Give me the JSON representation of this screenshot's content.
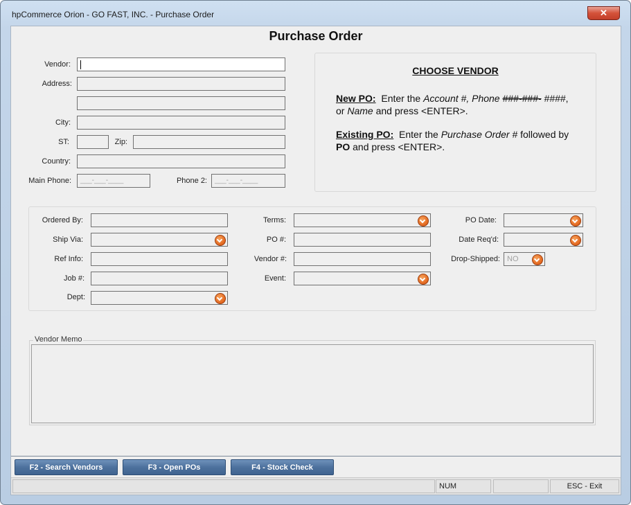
{
  "window": {
    "title": "hpCommerce Orion - GO FAST, INC. - Purchase Order",
    "close_glyph": "✕"
  },
  "page": {
    "heading": "Purchase Order"
  },
  "vendor_section": {
    "vendor_label": "Vendor:",
    "address_label": "Address:",
    "city_label": "City:",
    "st_label": "ST:",
    "zip_label": "Zip:",
    "country_label": "Country:",
    "main_phone_label": "Main Phone:",
    "main_phone_value": "___-___-____",
    "phone2_label": "Phone 2:",
    "phone2_value": "___-___-____"
  },
  "choose_vendor": {
    "title": "CHOOSE VENDOR",
    "new_po_label": "New PO:",
    "new_po_text_1": "Enter the ",
    "new_po_account": "Account #, Phone ",
    "new_po_mask_a": "###-###-",
    "new_po_mask_b": "####",
    "new_po_text_2": ", or ",
    "new_po_name": "Name",
    "new_po_text_3": " and press <ENTER>.",
    "existing_po_label": "Existing PO:",
    "existing_po_text_1": "Enter the ",
    "existing_po_po": "Purchase Order #",
    "existing_po_text_2": " followed by ",
    "existing_po_bold": "PO",
    "existing_po_text_3": " and press <ENTER>."
  },
  "order_fields": {
    "ordered_by_label": "Ordered By:",
    "ship_via_label": "Ship Via:",
    "ref_info_label": "Ref Info:",
    "job_label": "Job #:",
    "dept_label": "Dept:",
    "terms_label": "Terms:",
    "po_label": "PO #:",
    "vendor_no_label": "Vendor #:",
    "event_label": "Event:",
    "po_date_label": "PO Date:",
    "date_reqd_label": "Date Req'd:",
    "drop_shipped_label": "Drop-Shipped:",
    "drop_shipped_value": "NO"
  },
  "memo": {
    "legend": "Vendor Memo"
  },
  "function_keys": [
    {
      "label": "F2 - Search Vendors"
    },
    {
      "label": "F3 - Open POs"
    },
    {
      "label": "F4 - Stock Check"
    }
  ],
  "status_bar": {
    "num": "NUM",
    "blank": "",
    "esc": "ESC - Exit"
  },
  "colors": {
    "fkey_blue": "#4d719d",
    "dropdown_orange": "#e2661e",
    "close_red": "#d4523a"
  }
}
